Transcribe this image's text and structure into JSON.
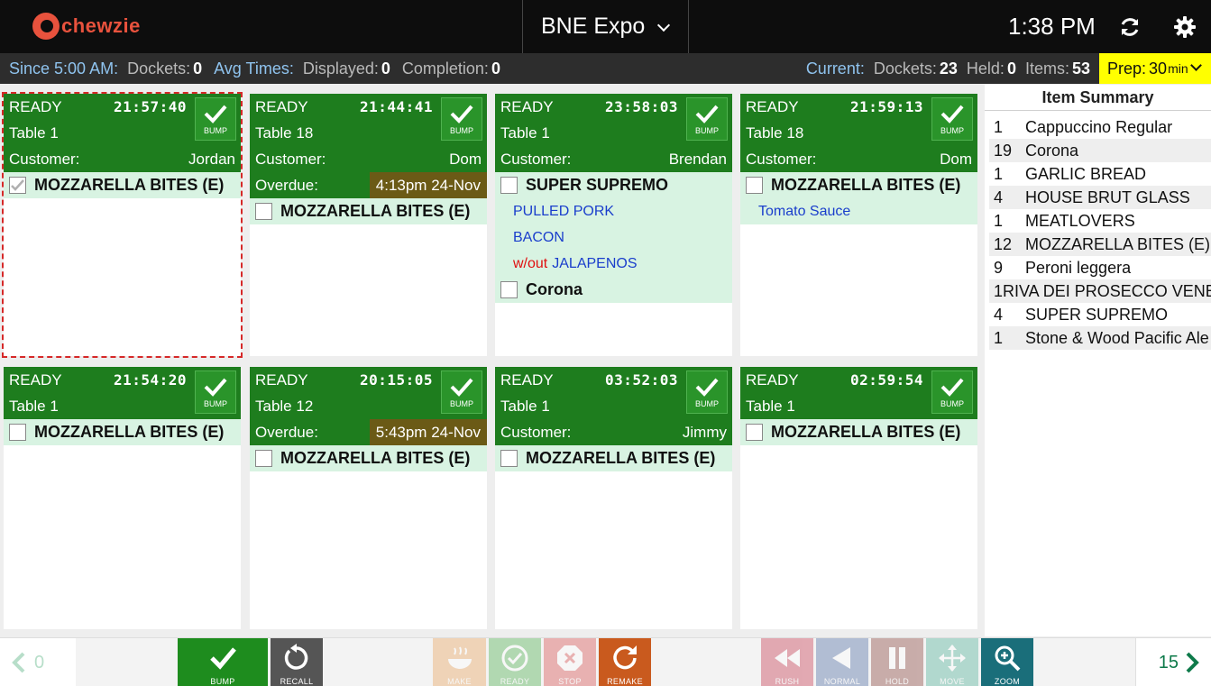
{
  "header": {
    "logo_text": "chewzie",
    "station": "BNE Expo",
    "time": "1:38 PM"
  },
  "stats": {
    "since_label": "Since 5:00 AM:",
    "dockets_label": "Dockets:",
    "dockets_value": "0",
    "avg_times_label": "Avg Times:",
    "displayed_label": "Displayed:",
    "displayed_value": "0",
    "completion_label": "Completion:",
    "completion_value": "0",
    "current_label": "Current:",
    "current_dockets_label": "Dockets:",
    "current_dockets_value": "23",
    "held_label": "Held:",
    "held_value": "0",
    "items_label": "Items:",
    "items_value": "53",
    "prep_label": "Prep:",
    "prep_value": "30",
    "prep_unit": "min"
  },
  "dockets": [
    {
      "status": "READY",
      "time": "21:57:40",
      "table": "Table 1",
      "customer_label": "Customer:",
      "customer": "Jordan",
      "bump": "BUMP",
      "items": [
        {
          "name": "MOZZARELLA BITES (E)",
          "checked": true
        }
      ]
    },
    {
      "status": "READY",
      "time": "21:44:41",
      "table": "Table 18",
      "customer_label": "Customer:",
      "customer": "Dom",
      "overdue_label": "Overdue:",
      "overdue": "4:13pm 24-Nov",
      "bump": "BUMP",
      "items": [
        {
          "name": "MOZZARELLA BITES (E)",
          "checked": false
        }
      ]
    },
    {
      "status": "READY",
      "time": "23:58:03",
      "table": "Table 1",
      "customer_label": "Customer:",
      "customer": "Brendan",
      "bump": "BUMP",
      "items": [
        {
          "name": "SUPER SUPREMO",
          "checked": false
        },
        {
          "name": "Corona",
          "checked": false
        }
      ],
      "mods": [
        "PULLED PORK",
        "BACON",
        "JALAPENOS"
      ],
      "without": "w/out"
    },
    {
      "status": "READY",
      "time": "21:59:13",
      "table": "Table 18",
      "customer_label": "Customer:",
      "customer": "Dom",
      "bump": "BUMP",
      "items": [
        {
          "name": "MOZZARELLA BITES (E)",
          "checked": false
        }
      ],
      "mods": [
        "Tomato Sauce"
      ]
    },
    {
      "status": "READY",
      "time": "21:54:20",
      "table": "Table 1",
      "bump": "BUMP",
      "items": [
        {
          "name": "MOZZARELLA BITES (E)",
          "checked": false
        }
      ]
    },
    {
      "status": "READY",
      "time": "20:15:05",
      "table": "Table 12",
      "overdue_label": "Overdue:",
      "overdue": "5:43pm 24-Nov",
      "bump": "BUMP",
      "items": [
        {
          "name": "MOZZARELLA BITES (E)",
          "checked": false
        }
      ]
    },
    {
      "status": "READY",
      "time": "03:52:03",
      "table": "Table 1",
      "customer_label": "Customer:",
      "customer": "Jimmy",
      "bump": "BUMP",
      "items": [
        {
          "name": "MOZZARELLA BITES (E)",
          "checked": false
        }
      ]
    },
    {
      "status": "READY",
      "time": "02:59:54",
      "table": "Table 1",
      "bump": "BUMP",
      "items": [
        {
          "name": "MOZZARELLA BITES (E)",
          "checked": false
        }
      ]
    }
  ],
  "summary": {
    "title": "Item Summary",
    "items": [
      {
        "qty": "1",
        "name": "Cappuccino Regular"
      },
      {
        "qty": "19",
        "name": "Corona"
      },
      {
        "qty": "1",
        "name": "GARLIC BREAD"
      },
      {
        "qty": "4",
        "name": "HOUSE BRUT GLASS"
      },
      {
        "qty": "1",
        "name": "MEATLOVERS"
      },
      {
        "qty": "12",
        "name": "MOZZARELLA BITES (E)"
      },
      {
        "qty": "9",
        "name": "Peroni leggera"
      },
      {
        "qty": "1",
        "name": "RIVA DEI PROSECCO VENETO"
      },
      {
        "qty": "4",
        "name": "SUPER SUPREMO"
      },
      {
        "qty": "1",
        "name": "Stone & Wood Pacific Ale"
      }
    ]
  },
  "toolbar": {
    "prev_count": "0",
    "next_count": "15",
    "bump": "BUMP",
    "recall": "RECALL",
    "make": "MAKE",
    "ready": "READY",
    "stop": "STOP",
    "remake": "REMAKE",
    "rush": "RUSH",
    "normal": "NORMAL",
    "hold": "HOLD",
    "move": "MOVE",
    "zoom": "ZOOM"
  },
  "colors": {
    "header_green": "#1e7d1e",
    "item_bg": "#d8f3e2",
    "overdue_bg": "#6b5a16",
    "prep_yellow": "#ffff00",
    "modifier_blue": "#1a3ecc",
    "without_red": "#e01010"
  }
}
